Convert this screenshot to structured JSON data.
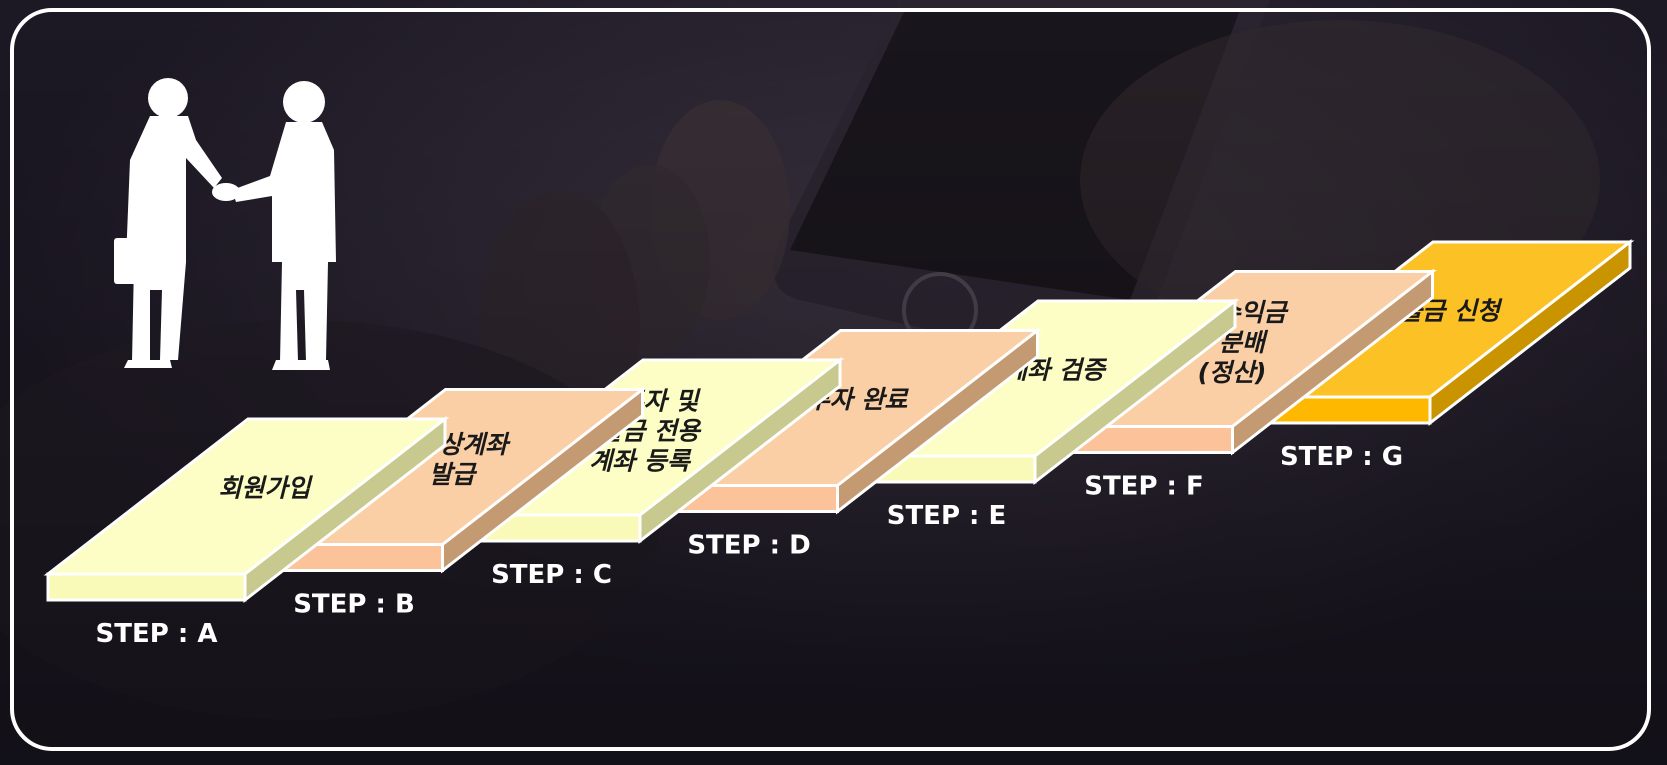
{
  "steps": [
    {
      "text_lines": [
        "회원가입"
      ],
      "label": "STEP : A"
    },
    {
      "text_lines": [
        "가상계좌",
        "발급"
      ],
      "label": "STEP : B"
    },
    {
      "text_lines": [
        "투자 및",
        "출금 전용",
        "계좌 등록"
      ],
      "label": "STEP : C"
    },
    {
      "text_lines": [
        "투자 완료"
      ],
      "label": "STEP : D"
    },
    {
      "text_lines": [
        "계좌 검증"
      ],
      "label": "STEP : E"
    },
    {
      "text_lines": [
        "수익금",
        "분배",
        "(정산)"
      ],
      "label": "STEP : F"
    },
    {
      "text_lines": [
        "출금 신청"
      ],
      "label": "STEP : G"
    }
  ],
  "colors": {
    "yellow_light": "#fdfdc6",
    "peach": "#fbcfa6",
    "gold": "#fcc124",
    "frame": "#ffffff",
    "background": "#1c1824"
  },
  "icons": {
    "handshake": "handshake-silhouette-icon"
  }
}
